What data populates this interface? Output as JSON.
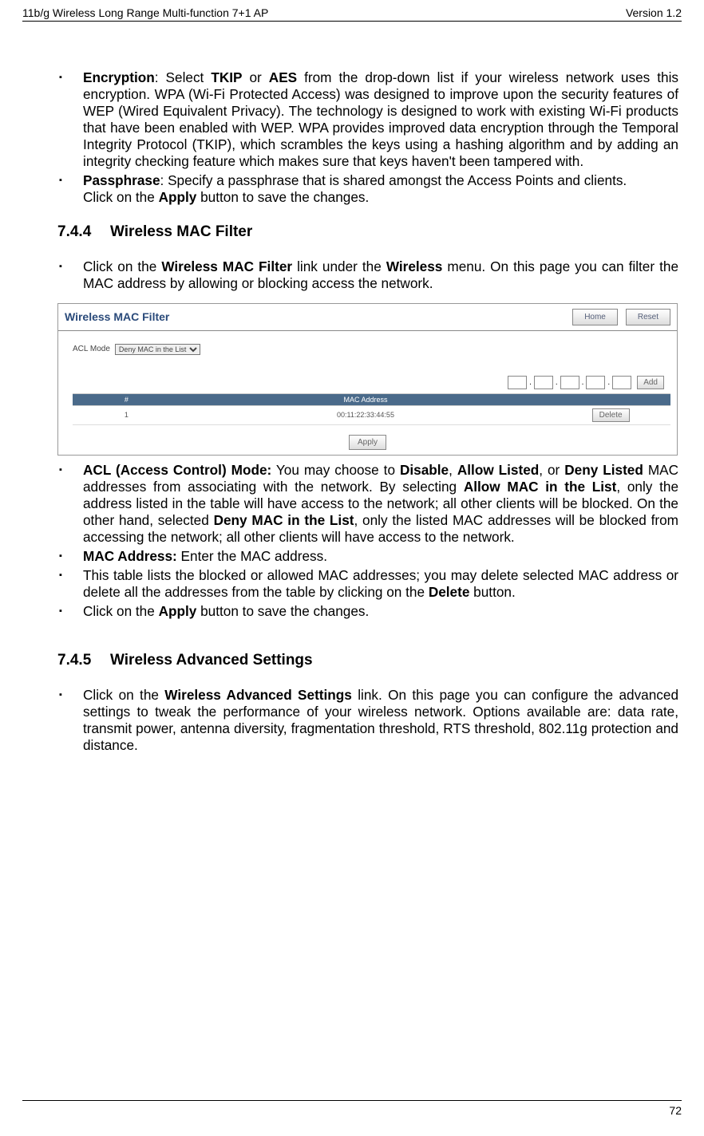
{
  "header": {
    "left": "11b/g Wireless Long Range Multi-function 7+1 AP",
    "right": "Version 1.2"
  },
  "items1": {
    "encryption_label": "Encryption",
    "encryption_text1": ": Select ",
    "encryption_tkip": "TKIP",
    "encryption_or": " or ",
    "encryption_aes": "AES",
    "encryption_text2": " from the drop-down list if your wireless network uses this encryption. WPA (Wi-Fi Protected Access) was designed to improve upon the security features of WEP (Wired Equivalent Privacy). The technology is designed to work with existing Wi-Fi products that have been enabled with WEP. WPA provides improved data encryption through the Temporal Integrity Protocol (TKIP), which scrambles the keys using a hashing algorithm and by adding an integrity checking feature which makes sure that keys haven't been tampered with.",
    "passphrase_label": "Passphrase",
    "passphrase_text": ": Specify a passphrase that is shared amongst the Access Points and clients.",
    "passphrase_text2a": "Click on the ",
    "passphrase_apply": "Apply",
    "passphrase_text2b": " button to save the changes."
  },
  "section744": {
    "num": "7.4.4",
    "title": "Wireless MAC Filter"
  },
  "items2_pre": "Click on the ",
  "items2_link": "Wireless MAC Filter",
  "items2_mid": " link under the ",
  "items2_link2": "Wireless",
  "items2_post": " menu. On this page you can filter the MAC address by allowing or blocking access the network.",
  "screenshot": {
    "title": "Wireless MAC Filter",
    "btn_home": "Home",
    "btn_reset": "Reset",
    "acl_label": "ACL Mode",
    "acl_option": "Deny MAC in the List",
    "add_btn": "Add",
    "tbl_head_num": "#",
    "tbl_head_mac": "MAC Address",
    "row_num": "1",
    "row_mac": "00:11:22:33:44:55",
    "delete_btn": "Delete",
    "apply_btn": "Apply"
  },
  "items3": {
    "acl_label": "ACL (Access Control) Mode:",
    "acl_t1": " You may choose to ",
    "acl_disable": "Disable",
    "acl_t2": ", ",
    "acl_allow": "Allow Listed",
    "acl_t3": ", or ",
    "acl_deny": "Deny Listed",
    "acl_t4": " MAC addresses from associating with the network. By selecting ",
    "acl_allowmac": "Allow MAC in the List",
    "acl_t5": ", only the address listed in the table will have access to the network; all other clients will be blocked. On the other hand, selected ",
    "acl_denymac": "Deny MAC in the List",
    "acl_t6": ", only the listed MAC addresses will be blocked from accessing the network; all other clients will have access to the network.",
    "mac_label": "MAC Address:",
    "mac_text": " Enter the MAC address.",
    "tbl_t1": "This table lists the blocked or allowed MAC addresses; you may delete selected MAC address or delete all the addresses from the table by clicking on the ",
    "tbl_delete": "Delete",
    "tbl_t2": " button.",
    "apply_t1": "Click on the ",
    "apply_b": "Apply",
    "apply_t2": " button to save the changes."
  },
  "section745": {
    "num": "7.4.5",
    "title": "Wireless Advanced Settings"
  },
  "items4_pre": "Click on the ",
  "items4_link": "Wireless Advanced Settings",
  "items4_post": " link. On this page you can configure the advanced settings to tweak the performance of your wireless network. Options available are: data rate, transmit power, antenna diversity, fragmentation threshold, RTS threshold, 802.11g protection and distance.",
  "footer": {
    "page": "72"
  }
}
